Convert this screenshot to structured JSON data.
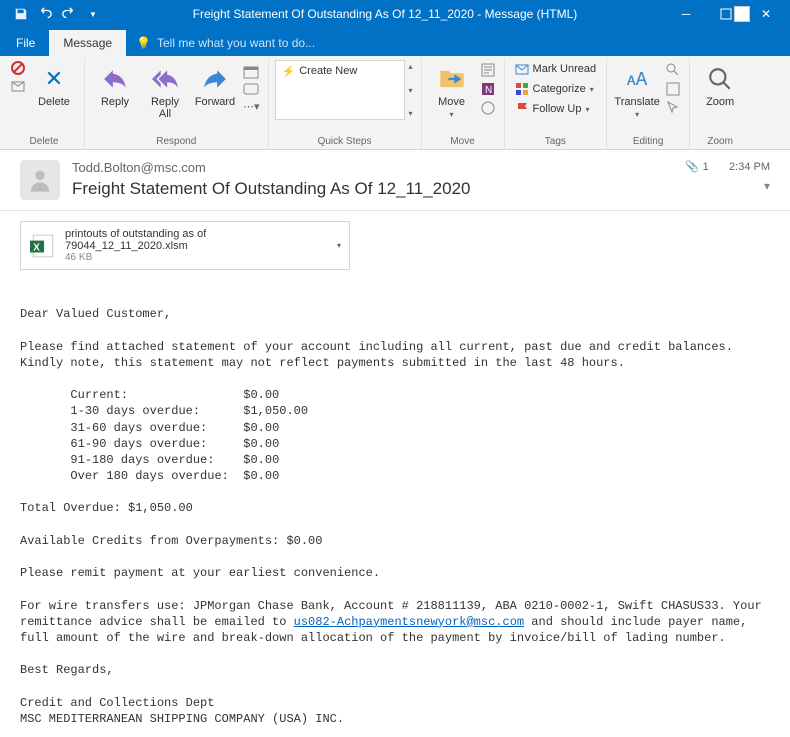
{
  "window": {
    "title": "Freight Statement Of Outstanding As Of 12_11_2020 - Message (HTML)"
  },
  "tabs": {
    "file": "File",
    "message": "Message",
    "tellme": "Tell me what you want to do..."
  },
  "ribbon": {
    "delete": {
      "label": "Delete",
      "group": "Delete"
    },
    "respond": {
      "reply": "Reply",
      "replyall": "Reply\nAll",
      "forward": "Forward",
      "group": "Respond"
    },
    "quicksteps": {
      "create": "Create New",
      "group": "Quick Steps"
    },
    "move": {
      "label": "Move",
      "group": "Move"
    },
    "tags": {
      "unread": "Mark Unread",
      "categorize": "Categorize",
      "followup": "Follow Up",
      "group": "Tags"
    },
    "editing": {
      "translate": "Translate",
      "group": "Editing"
    },
    "zoom": {
      "label": "Zoom",
      "group": "Zoom"
    }
  },
  "message": {
    "from": "Todd.Bolton@msc.com",
    "subject": "Freight Statement Of Outstanding As Of 12_11_2020",
    "time": "2:34 PM",
    "attachments_count": "1",
    "attachment": {
      "name": "printouts of outstanding as of 79044_12_11_2020.xlsm",
      "size": "46 KB"
    },
    "body": {
      "greet": "Dear Valued Customer,",
      "p1": "Please find attached statement of your account including all current, past due and credit balances.",
      "p2": "Kindly note, this statement may not reflect payments submitted in the last 48 hours.",
      "rows": {
        "current_l": "Current:",
        "current_v": "$0.00",
        "d1_l": "1-30 days overdue:",
        "d1_v": "$1,050.00",
        "d2_l": "31-60 days overdue:",
        "d2_v": "$0.00",
        "d3_l": "61-90 days overdue:",
        "d3_v": "$0.00",
        "d4_l": "91-180 days overdue:",
        "d4_v": "$0.00",
        "d5_l": "Over 180 days overdue:",
        "d5_v": "$0.00"
      },
      "total": "Total Overdue: $1,050.00",
      "credits": "Available Credits from Overpayments: $0.00",
      "remit": "Please remit payment at your earliest convenience.",
      "wire1": "For wire transfers use: JPMorgan Chase Bank, Account # 218811139, ABA 0210-0002-1, Swift CHASUS33. Your",
      "wire2a": "remittance advice shall be emailed to ",
      "wire_email": "us082-Achpaymentsnewyork@msc.com",
      "wire2b": " and should include payer name,",
      "wire3": "full amount of the wire and break-down allocation of the payment by invoice/bill of lading number.",
      "regards": "Best Regards,",
      "sig1": "Credit and Collections Dept",
      "sig2": "MSC MEDITERRANEAN SHIPPING COMPANY (USA) INC."
    }
  }
}
